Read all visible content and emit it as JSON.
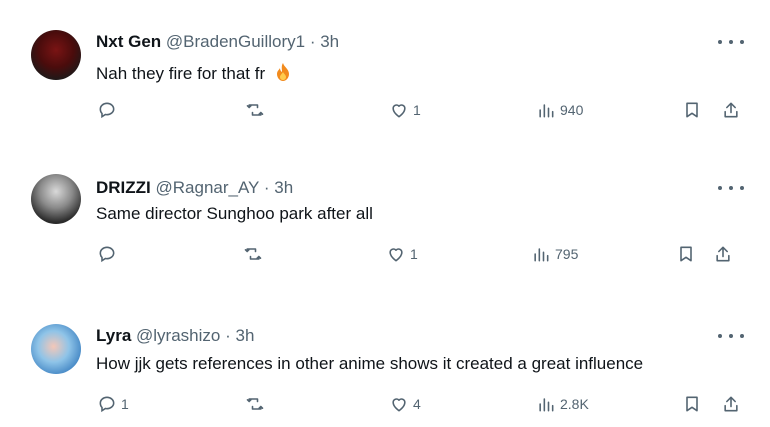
{
  "replies": [
    {
      "name": "Nxt Gen",
      "handle": "@BradenGuillory1",
      "separator": "·",
      "time": "3h",
      "text": "Nah they fire for that fr",
      "emoji": "fire-emoji",
      "stats": {
        "replies": "",
        "reposts": "",
        "likes": "1",
        "views": "940"
      }
    },
    {
      "name": "DRIZZI",
      "handle": "@Ragnar_AY",
      "separator": "·",
      "time": "3h",
      "text": "Same director Sunghoo park after all",
      "stats": {
        "replies": "",
        "reposts": "",
        "likes": "1",
        "views": "795"
      }
    },
    {
      "name": "Lyra",
      "handle": "@lyrashizo",
      "separator": "·",
      "time": "3h",
      "text": "How jjk gets references in other anime shows it created a great influence",
      "stats": {
        "replies": "1",
        "reposts": "",
        "likes": "4",
        "views": "2.8K"
      }
    }
  ],
  "colors": {
    "text": "#0f1419",
    "muted": "#536471",
    "background": "#ffffff",
    "flame": "#f28b1d"
  }
}
